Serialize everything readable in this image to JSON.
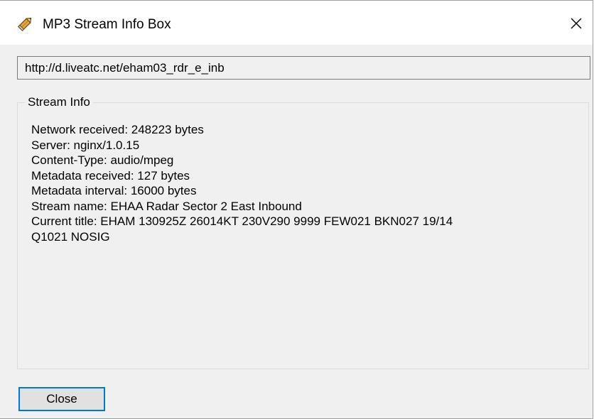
{
  "window": {
    "title": "MP3 Stream Info Box",
    "icon": "pencil-icon",
    "close_icon": "close-icon"
  },
  "url_field": {
    "value": "http://d.liveatc.net/eham03_rdr_e_inb"
  },
  "stream_info": {
    "legend": "Stream Info",
    "lines": [
      "Network received: 248223 bytes",
      "Server: nginx/1.0.15",
      "Content-Type: audio/mpeg",
      "Metadata received: 127 bytes",
      "Metadata interval: 16000 bytes",
      "Stream name: EHAA Radar Sector 2 East Inbound",
      "Current title: EHAM 130925Z 26014KT 230V290 9999 FEW021 BKN027 19/14",
      "Q1021 NOSIG"
    ]
  },
  "buttons": {
    "close_label": "Close"
  },
  "colors": {
    "client_background": "#f0f0f0",
    "titlebar_background": "#ffffff",
    "focus_border": "#0078d7",
    "button_face": "#e1e1e1"
  }
}
